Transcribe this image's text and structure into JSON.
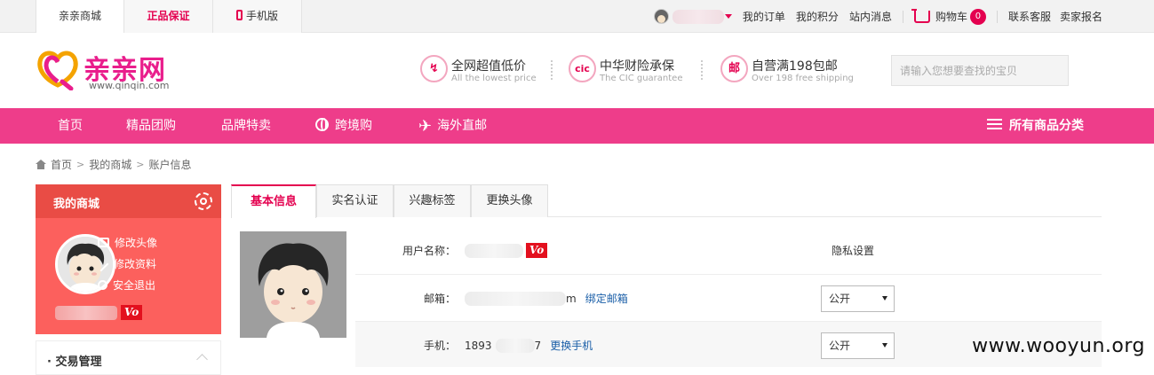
{
  "topbar": {
    "tabs": [
      "亲亲商城",
      "正品保证",
      "手机版"
    ],
    "links": [
      "我的订单",
      "我的积分",
      "站内消息"
    ],
    "cart_label": "购物车",
    "cart_count": "0",
    "service_links": [
      "联系客服",
      "卖家报名"
    ]
  },
  "header": {
    "logo_text": "亲亲网",
    "logo_url": "www.qinqin.com",
    "promos": [
      {
        "icon_glyph": "↯",
        "icon": "price-down-icon",
        "title": "全网超值低价",
        "subtitle": "All the lowest price"
      },
      {
        "icon_glyph": "cic",
        "icon": "insurance-icon",
        "title": "中华财险承保",
        "subtitle": "The CIC guarantee"
      },
      {
        "icon_glyph": "邮",
        "icon": "mail-icon",
        "title": "自营满198包邮",
        "subtitle": "Over 198 free shipping"
      }
    ],
    "search_placeholder": "请输入您想要查找的宝贝"
  },
  "nav": {
    "items": [
      "首页",
      "精品团购",
      "品牌特卖",
      "跨境购",
      "海外直邮"
    ],
    "all_categories": "所有商品分类"
  },
  "breadcrumb": [
    "首页",
    "我的商城",
    "账户信息"
  ],
  "sidebar": {
    "title": "我的商城",
    "actions": [
      "修改头像",
      "修改资料",
      "安全退出"
    ],
    "vip": "Vo",
    "menu_section": "· 交易管理"
  },
  "tabs": [
    "基本信息",
    "实名认证",
    "兴趣标签",
    "更换头像"
  ],
  "form": {
    "username_label": "用户名称：",
    "vip": "Vo",
    "privacy_title": "隐私设置",
    "email_label": "邮箱：",
    "email_tail": "m",
    "bind_email": "绑定邮箱",
    "phone_label": "手机：",
    "phone_prefix": "1893",
    "phone_suffix": "7",
    "change_phone": "更换手机",
    "privacy_options": [
      "公开",
      "公开"
    ]
  },
  "watermark": "www.wooyun.org",
  "colors": {
    "brand": "#e4004f",
    "nav": "#ee3d8a",
    "sidebar": "#fc605d"
  }
}
